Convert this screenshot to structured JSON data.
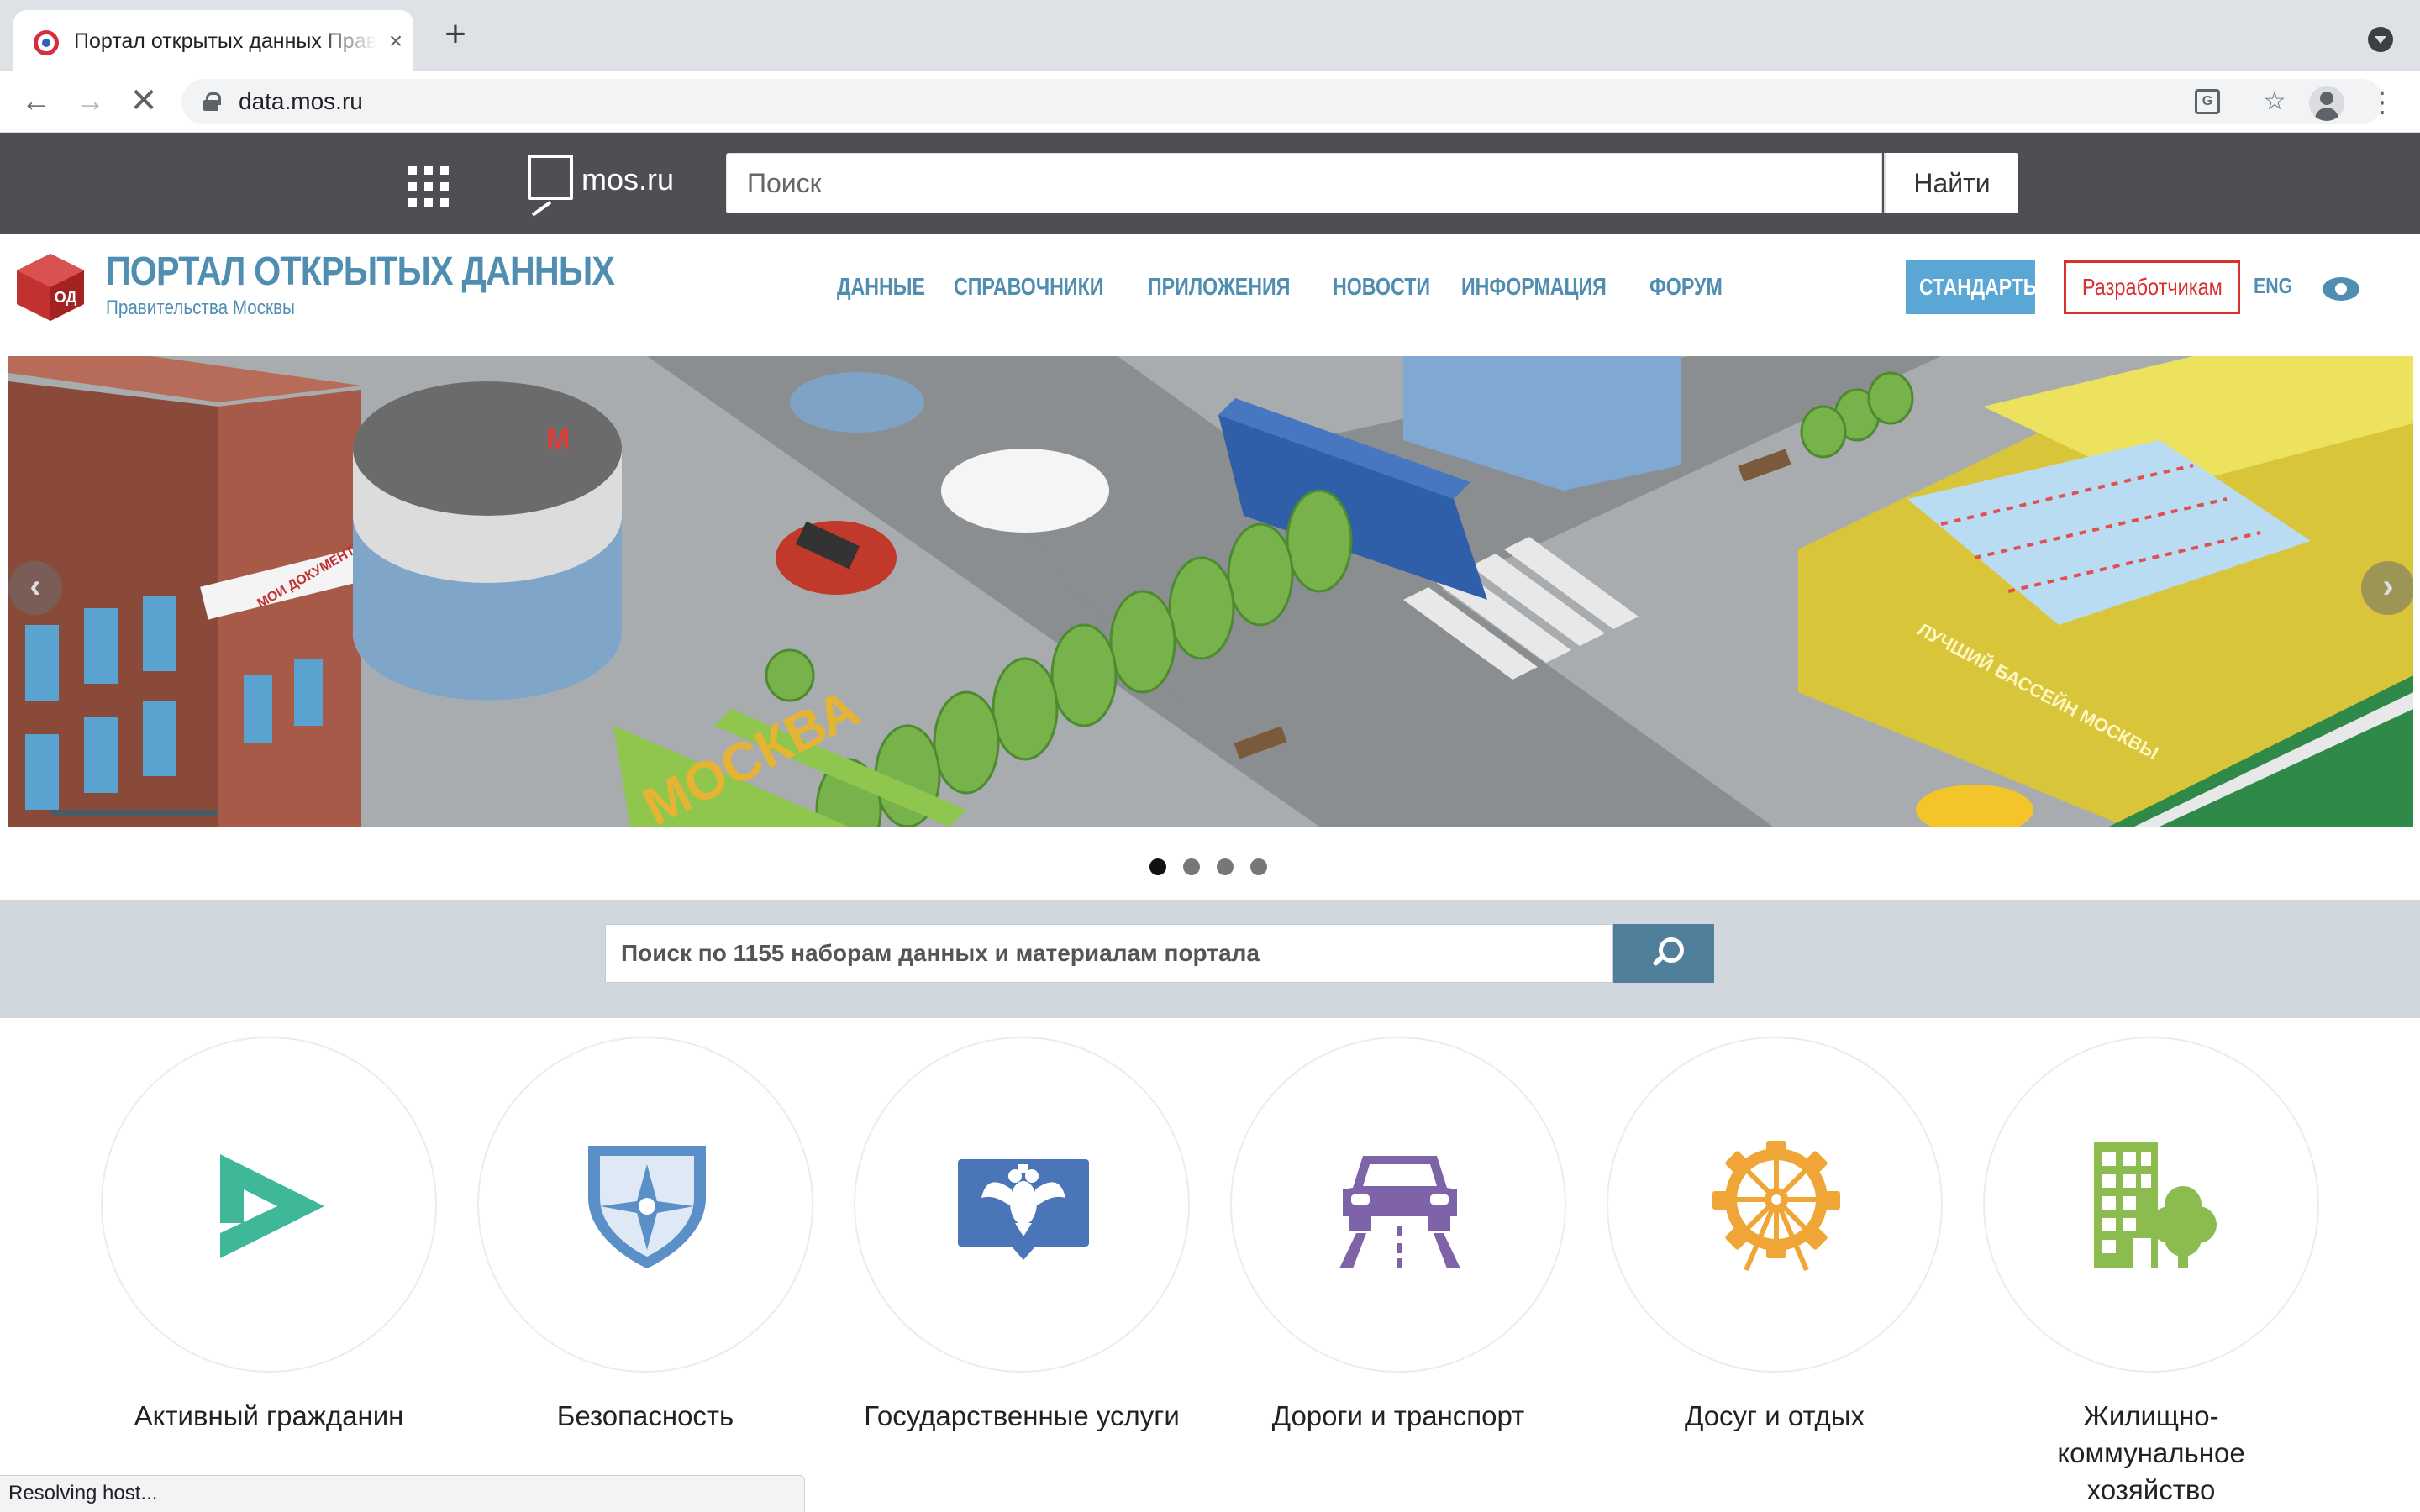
{
  "browser": {
    "tab_title": "Портал открытых данных Правительства Москвы",
    "tab_close": "×",
    "new_tab": "+",
    "url": "data.mos.ru",
    "status_text": "Resolving host..."
  },
  "mosbar": {
    "logo_text": "mos.ru",
    "search_placeholder": "Поиск",
    "search_button": "Найти"
  },
  "portal": {
    "title": "ПОРТАЛ ОТКРЫТЫХ ДАННЫХ",
    "subtitle": "Правительства Москвы",
    "logo_badge": "ОД",
    "nav": [
      "ДАННЫЕ",
      "СПРАВОЧНИКИ",
      "ПРИЛОЖЕНИЯ",
      "НОВОСТИ",
      "ИНФОРМАЦИЯ",
      "ФОРУМ"
    ],
    "standards_button": "СТАНДАРТЫ",
    "developers_button": "Разработчикам",
    "lang": "ENG",
    "accent_color": "#4f8db1",
    "brand_red": "#c0312f"
  },
  "carousel": {
    "banner_texts": [
      "МОСКВА",
      "ЛУЧШИЙ БАССЕЙН МОСКВЫ",
      "МОИ ДОКУМЕНТЫ"
    ],
    "prev_icon": "chevron-left-icon",
    "next_icon": "chevron-right-icon",
    "slide_count": 4,
    "active_slide": 1
  },
  "data_search": {
    "placeholder": "Поиск по 1155 наборам данных и материалам портала"
  },
  "categories": [
    {
      "label": "Активный гражданин",
      "icon": "active-citizen-icon",
      "color": "#3fb89a"
    },
    {
      "label": "Безопасность",
      "icon": "shield-icon",
      "color": "#5b8fc7"
    },
    {
      "label": "Государственные услуги",
      "icon": "coat-of-arms-icon",
      "color": "#4a76b9"
    },
    {
      "label": "Дороги и транспорт",
      "icon": "car-icon",
      "color": "#7f63a8"
    },
    {
      "label": "Досуг и отдых",
      "icon": "ferris-wheel-icon",
      "color": "#f0a637"
    },
    {
      "label": "Жилищно-\nкоммунальное\nхозяйство",
      "icon": "building-tree-icon",
      "color": "#8cbc4f"
    }
  ]
}
